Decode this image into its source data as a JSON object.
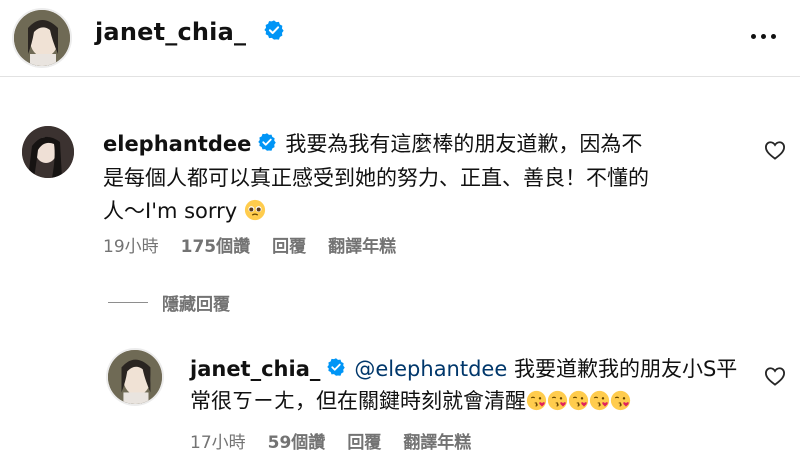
{
  "header": {
    "username": "janet_chia_",
    "avatar_icon": "profile-photo-janet",
    "more_icon": "more-options-icon"
  },
  "comment": {
    "username": "elephantdee",
    "text": "我要為我有這麼棒的朋友道歉，因為不是每個人都可以真正感受到她的努力、正直、善良！不懂的人～I'm sorry",
    "emoji": "pleading-face",
    "time": "19小時",
    "likes": "175個讚",
    "reply_label": "回覆",
    "translate_label": "翻譯年糕"
  },
  "hide_replies_label": "隱藏回覆",
  "reply": {
    "username": "janet_chia_",
    "mention": "@elephantdee",
    "text": "我要道歉我的朋友小S平常很ㄎㄧㄤ，但在關鍵時刻就會清醒",
    "emoji": "face-blowing-kiss",
    "emoji_count": 5,
    "time": "17小時",
    "likes": "59個讚",
    "reply_label": "回覆",
    "translate_label": "翻譯年糕"
  },
  "colors": {
    "verified": "#0095f6",
    "meta_text": "#737373",
    "mention": "#00376b"
  }
}
